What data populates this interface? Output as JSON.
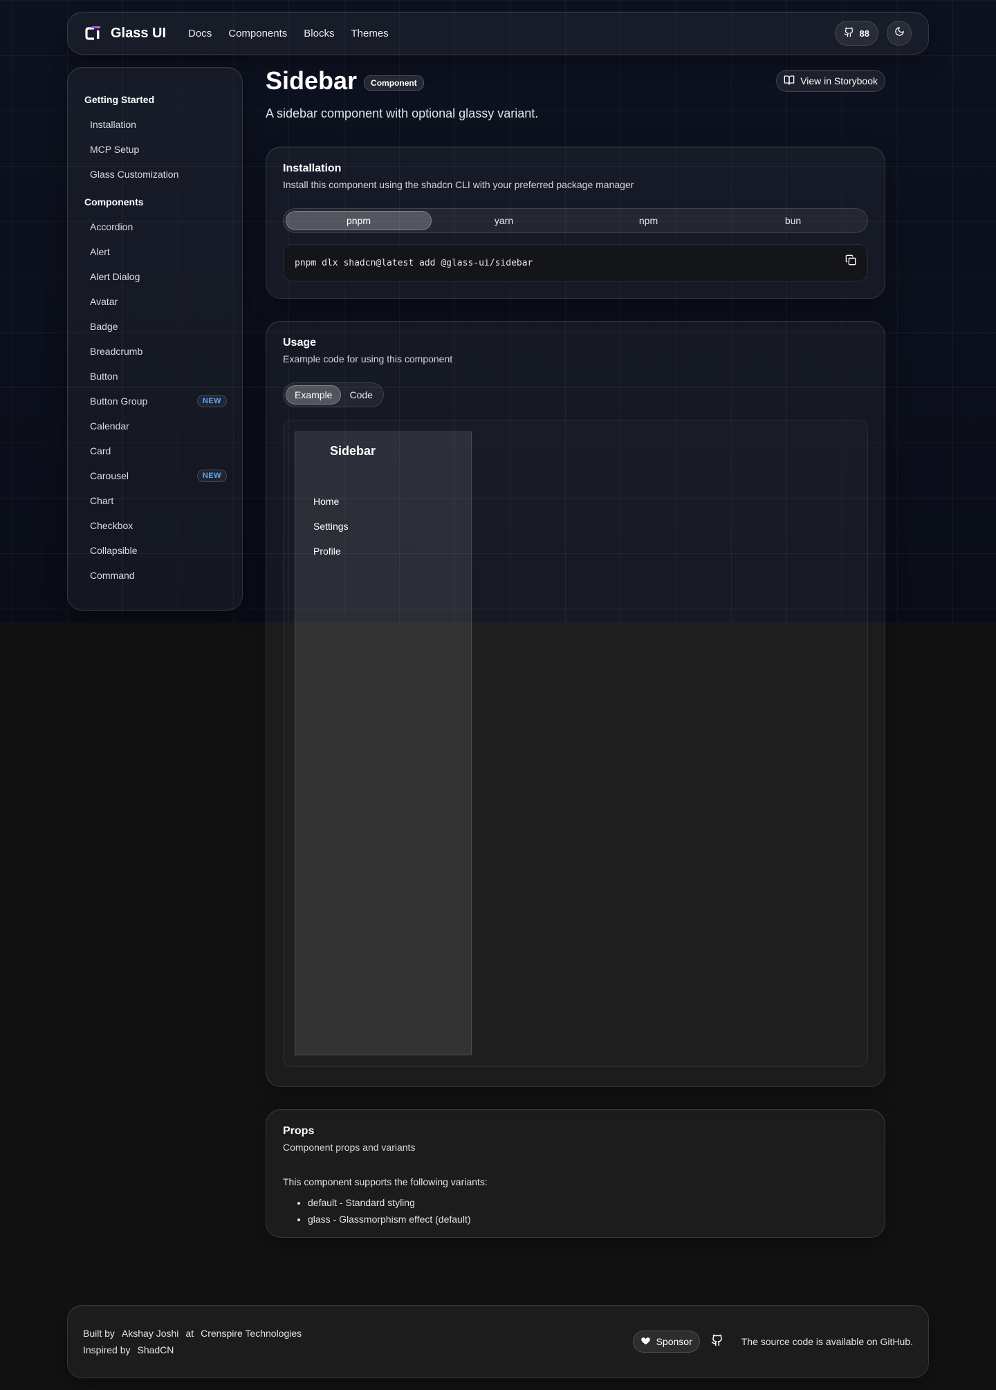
{
  "header": {
    "logo_mark": "CI",
    "logo_text": "Glass UI",
    "nav": [
      "Docs",
      "Components",
      "Blocks",
      "Themes"
    ],
    "github_stars": "88"
  },
  "sidenav": {
    "groups": [
      {
        "title": "Getting Started",
        "items": [
          {
            "label": "Installation"
          },
          {
            "label": "MCP Setup"
          },
          {
            "label": "Glass Customization"
          }
        ]
      },
      {
        "title": "Components",
        "items": [
          {
            "label": "Accordion"
          },
          {
            "label": "Alert"
          },
          {
            "label": "Alert Dialog"
          },
          {
            "label": "Avatar"
          },
          {
            "label": "Badge"
          },
          {
            "label": "Breadcrumb"
          },
          {
            "label": "Button"
          },
          {
            "label": "Button Group",
            "badge": "NEW"
          },
          {
            "label": "Calendar"
          },
          {
            "label": "Card"
          },
          {
            "label": "Carousel",
            "badge": "NEW"
          },
          {
            "label": "Chart"
          },
          {
            "label": "Checkbox"
          },
          {
            "label": "Collapsible"
          },
          {
            "label": "Command"
          }
        ]
      }
    ]
  },
  "page": {
    "title": "Sidebar",
    "badge": "Component",
    "storybook_label": "View in Storybook",
    "description": "A sidebar component with optional glassy variant."
  },
  "installation": {
    "title": "Installation",
    "subtitle": "Install this component using the shadcn CLI with your preferred package manager",
    "tabs": [
      "pnpm",
      "yarn",
      "npm",
      "bun"
    ],
    "active_tab": "pnpm",
    "command": "pnpm dlx shadcn@latest add @glass-ui/sidebar"
  },
  "usage": {
    "title": "Usage",
    "subtitle": "Example code for using this component",
    "tabs": [
      "Example",
      "Code"
    ],
    "active_tab": "Example",
    "demo": {
      "title": "Sidebar",
      "items": [
        "Home",
        "Settings",
        "Profile"
      ]
    }
  },
  "props": {
    "title": "Props",
    "subtitle": "Component props and variants",
    "intro": "This component supports the following variants:",
    "variants": [
      "default - Standard styling",
      "glass - Glassmorphism effect (default)"
    ]
  },
  "footer": {
    "built_by": "Built by",
    "author": "Akshay Joshi",
    "at": "at",
    "company": "Crenspire Technologies",
    "inspired_by": "Inspired by",
    "inspiration": "ShadCN",
    "sponsor_label": "Sponsor",
    "github_text": "The source code is available on GitHub."
  },
  "colors": {
    "accent_new_badge": "#5aa8ff",
    "logo_gradient_start": "#7c5cff",
    "logo_gradient_end": "#ff4fd8"
  },
  "icons": {
    "github_stars": "github-icon",
    "theme_toggle": "moon-icon",
    "storybook": "book-open-icon",
    "copy": "copy-icon",
    "sponsor": "heart-icon",
    "footer_github": "github-icon"
  }
}
